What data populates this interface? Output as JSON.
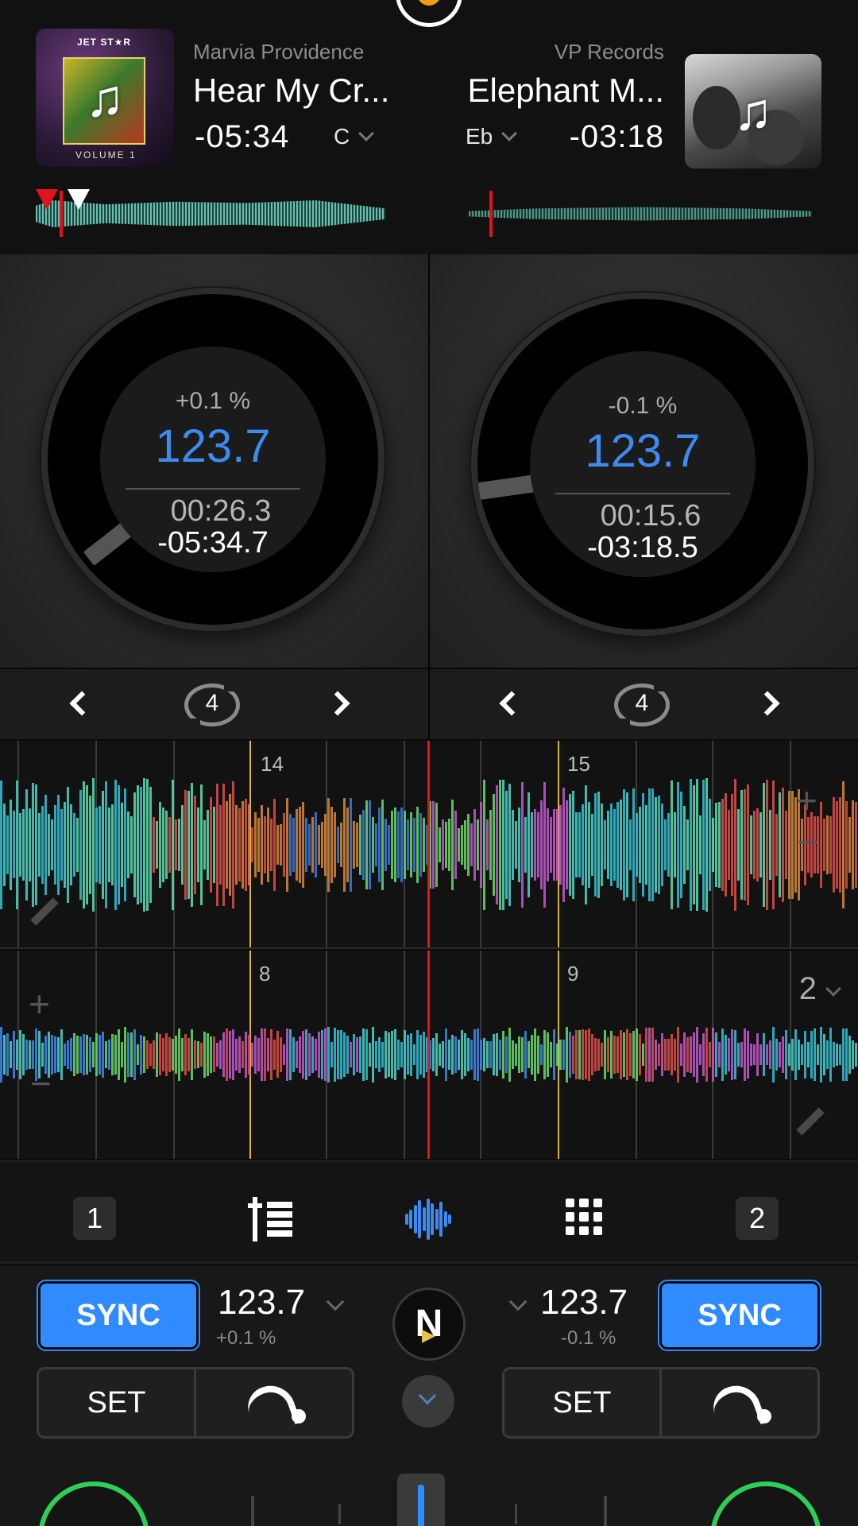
{
  "deck_left": {
    "artist": "Marvia Providence",
    "title": "Hear My Cr...",
    "time_remaining": "-05:34",
    "key": "C",
    "cover_label_top": "JET ST★R",
    "cover_label_bottom": "VOLUME 1",
    "pitch": "+0.1 %",
    "bpm": "123.7",
    "elapsed": "00:26.3",
    "remaining": "-05:34.7",
    "loop_size": "4",
    "sync_label": "SYNC",
    "set_label": "SET",
    "deck_number": "1"
  },
  "deck_right": {
    "artist": "VP Records",
    "title": "Elephant M...",
    "time_remaining": "-03:18",
    "key": "Eb",
    "pitch": "-0.1 %",
    "bpm": "123.7",
    "elapsed": "00:15.6",
    "remaining": "-03:18.5",
    "loop_size": "4",
    "sync_label": "SYNC",
    "set_label": "SET",
    "deck_number": "2"
  },
  "waveform_1": {
    "bar_a": "14",
    "bar_b": "15"
  },
  "waveform_2": {
    "bar_a": "8",
    "bar_b": "9",
    "deck_select": "2"
  },
  "transport": {
    "left_bpm": "123.7",
    "left_pitch": "+0.1 %",
    "right_bpm": "123.7",
    "right_pitch": "-0.1 %",
    "center_logo": "N"
  },
  "icons": {
    "music_note": "♫",
    "plus": "+",
    "minus": "−"
  },
  "colors": {
    "accent_blue": "#2f8bff",
    "bpm_blue": "#3d8bf0",
    "playhead_red": "#e0141e",
    "beat_yellow": "#d8b23a",
    "play_green": "#2fcf55"
  }
}
